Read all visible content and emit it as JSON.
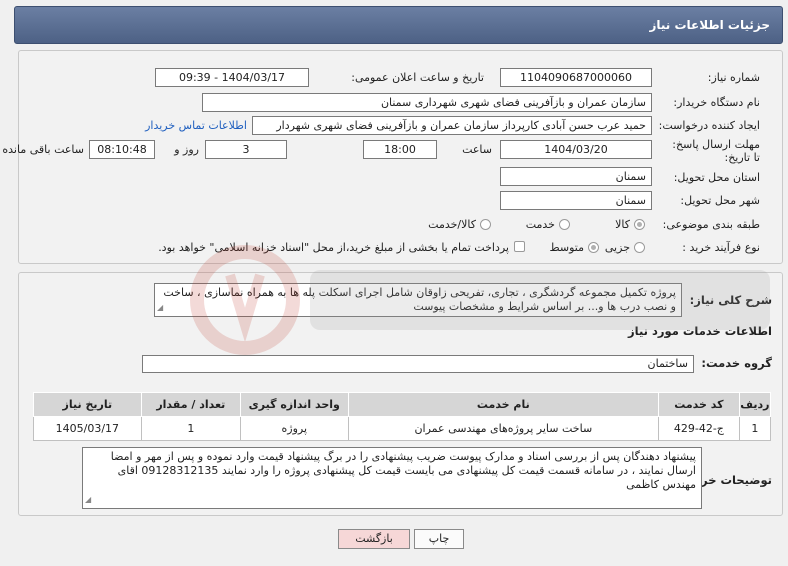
{
  "header": {
    "title": "جزئیات اطلاعات نیاز"
  },
  "fields": {
    "need_number_label": "شماره نیاز:",
    "need_number": "1104090687000060",
    "announce_label": "تاریخ و ساعت اعلان عمومی:",
    "announce_value": "1404/03/17 - 09:39",
    "buyer_org_label": "نام دستگاه خریدار:",
    "buyer_org": "سازمان عمران و بازآفرینی فضای شهری شهرداری سمنان",
    "creator_label": "ایجاد کننده درخواست:",
    "creator": "حمید عرب حسن آبادی کارپرداز سازمان عمران و بازآفرینی فضای شهری شهردار",
    "contact_link": "اطلاعات تماس خریدار",
    "deadline_label": "مهلت ارسال پاسخ: تا تاریخ:",
    "deadline_date": "1404/03/20",
    "time_label": "ساعت",
    "deadline_time": "18:00",
    "days_value": "3",
    "days_label": "روز و",
    "remaining_time": "08:10:48",
    "remaining_label": "ساعت باقی مانده",
    "province_label": "استان محل تحویل:",
    "province": "سمنان",
    "city_label": "شهر محل تحویل:",
    "city": "سمنان",
    "category_label": "طبقه بندی موضوعی:",
    "category_options": [
      "کالا",
      "خدمت",
      "کالا/خدمت"
    ],
    "process_label": "نوع فرآیند خرید :",
    "process_options": [
      "جزیی",
      "متوسط"
    ],
    "payment_note": "پرداخت تمام یا بخشی از مبلغ خرید،از محل \"اسناد خزانه اسلامی\" خواهد بود."
  },
  "summary": {
    "label": "شرح کلی نیاز:",
    "text": "پروژه تکمیل مجموعه گردشگری ، تجاری، تفریحی زاوقان شامل اجرای اسکلت پله ها به همراه نماسازی ، ساخت و نصب درب ها و... بر اساس  شرایط و مشخصات پیوست"
  },
  "services": {
    "section_title": "اطلاعات خدمات مورد نیاز",
    "group_label": "گروه خدمت:",
    "group_value": "ساختمان",
    "columns": [
      "ردیف",
      "کد خدمت",
      "نام خدمت",
      "واحد اندازه گیری",
      "تعداد / مقدار",
      "تاریخ نیاز"
    ],
    "rows": [
      [
        "1",
        "ج-42-429",
        "ساخت سایر پروژه‌های مهندسی عمران",
        "پروژه",
        "1",
        "1405/03/17"
      ]
    ]
  },
  "buyer_notes": {
    "label": "توضیحات خریدار:",
    "text": "پیشنهاد دهندگان پس از بررسی اسناد و مدارک پیوست ضریب پیشنهادی را در برگ پیشنهاد قیمت وارد نموده و پس از مهر و امضا ارسال نمایند ، در سامانه قسمت  قیمت کل پیشنهادی می بایست قیمت کل پیشنهادی پروژه را وارد نمایند 09128312135 اقای مهندس کاظمی"
  },
  "buttons": {
    "print": "چاپ",
    "back": "بازگشت"
  },
  "colors": {
    "header_bg": "#5a6e94",
    "link": "#1f5fbf",
    "back_button_bg": "#f6d7d7"
  }
}
